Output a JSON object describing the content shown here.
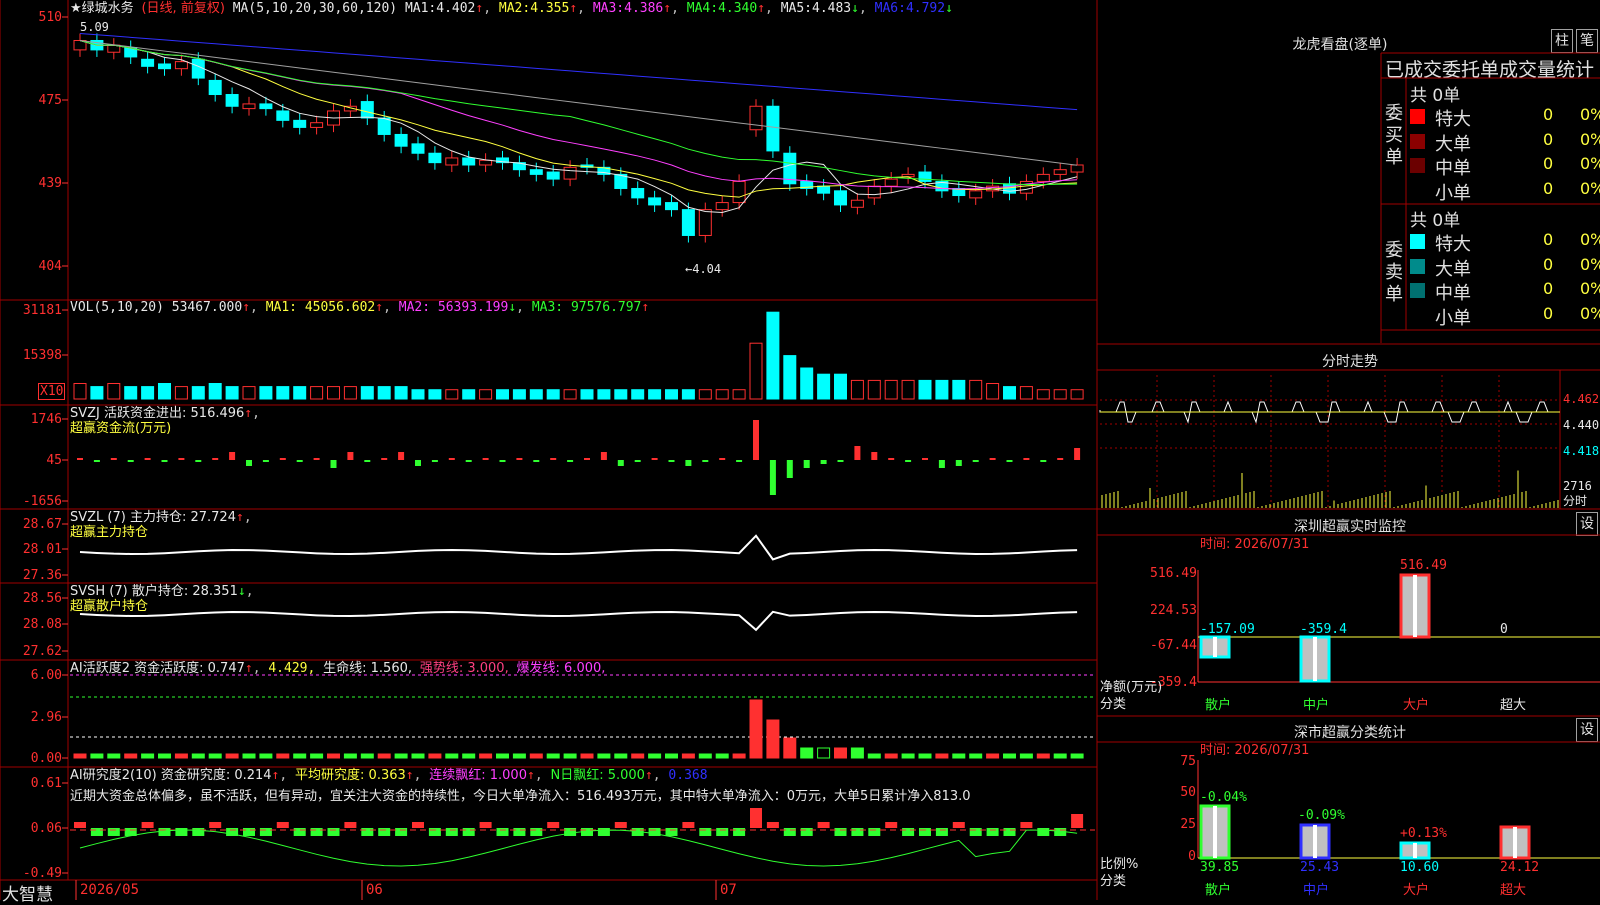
{
  "header": {
    "stock_name": "★绿城水务",
    "period": "(日线, 前复权)",
    "ma_label": "MA(5,10,20,30,60,120)",
    "ma": [
      {
        "label": "MA1:",
        "value": "4.402",
        "arrow": "↑"
      },
      {
        "label": "MA2:",
        "value": "4.355",
        "arrow": "↑"
      },
      {
        "label": "MA3:",
        "value": "4.386",
        "arrow": "↑"
      },
      {
        "label": "MA4:",
        "value": "4.340",
        "arrow": "↑"
      },
      {
        "label": "MA5:",
        "value": "4.483",
        "arrow": "↓"
      },
      {
        "label": "MA6:",
        "value": "4.792",
        "arrow": "↓"
      }
    ],
    "high_mark": "5.09",
    "low_mark": "←4.04"
  },
  "price_axis": [
    "510",
    "475",
    "439",
    "404"
  ],
  "vol": {
    "title": "VOL(5,10,20)",
    "value": "53467.000",
    "ma1": "MA1: 45056.602",
    "ma2": "MA2: 56393.199",
    "ma3": "MA3: 97576.797",
    "axis": [
      "31181",
      "15398"
    ],
    "unit": "X10"
  },
  "svzj": {
    "title": "SVZJ  活跃资金进出: 516.496",
    "subtitle": "超赢资金流(万元)",
    "axis": [
      "1746",
      "45",
      "-1656"
    ]
  },
  "svzl": {
    "title": "SVZL (7) 主力持仓: 27.724",
    "subtitle": "超赢主力持仓",
    "axis": [
      "28.67",
      "28.01",
      "27.36"
    ]
  },
  "svsh": {
    "title": "SVSH (7) 散户持仓: 28.351",
    "subtitle": "超赢散户持仓",
    "axis": [
      "28.56",
      "28.08",
      "27.62"
    ]
  },
  "ai1": {
    "title": "AI活跃度2 资金活跃度: 0.747",
    "v2": "4.429,",
    "life": "生命线: 1.560,",
    "strong": "强势线: 3.000,",
    "burst": "爆发线: 6.000,",
    "axis": [
      "6.00",
      "2.96",
      "0.00"
    ]
  },
  "ai2": {
    "title": "AI研究度2(10) 资金研究度: 0.214",
    "avg": "平均研究度: 0.363",
    "cont": "连续飘红: 1.000",
    "ndays": "N日飘红: 5.000",
    "last": "0.368",
    "comment": "近期大资金总体偏多，虽不活跃，但有异动，宜关注大资金的持续性，今日大单净流入：516.493万元，其中特大单净流入：0万元，大单5日累计净入813.0",
    "axis": [
      "0.61",
      "0.06",
      "-0.49"
    ]
  },
  "dates": {
    "brand": "大智慧",
    "d1": "2026/05",
    "d2": "06",
    "d3": "07"
  },
  "right": {
    "lhb_title": "龙虎看盘(逐单)",
    "btn1": "柱",
    "btn2": "笔",
    "stats_title": "已成交委托单成交量统计",
    "buy_label": "委买单",
    "sell_label": "委卖单",
    "buy_total": "共 0单",
    "sell_total": "共 0单",
    "buy_rows": [
      {
        "name": "特大",
        "count": "0",
        "pct": "0%",
        "color": "#ff0000"
      },
      {
        "name": "大单",
        "count": "0",
        "pct": "0%",
        "color": "#8b0000"
      },
      {
        "name": "中单",
        "count": "0",
        "pct": "0%",
        "color": "#6b0000"
      },
      {
        "name": "小单",
        "count": "0",
        "pct": "0%",
        "color": "#000000"
      }
    ],
    "sell_rows": [
      {
        "name": "特大",
        "count": "0",
        "pct": "0%",
        "color": "#00ffff"
      },
      {
        "name": "大单",
        "count": "0",
        "pct": "0%",
        "color": "#008b8b"
      },
      {
        "name": "中单",
        "count": "0",
        "pct": "0%",
        "color": "#007070"
      },
      {
        "name": "小单",
        "count": "0",
        "pct": "0%",
        "color": "#000000"
      }
    ],
    "fs_title": "分时走势",
    "fs_axis": [
      "4.462",
      "4.440",
      "4.418"
    ],
    "fs_vol": "2716",
    "fs_vol_label": "分时",
    "monitor_title": "深圳超赢实时监控",
    "monitor_btn": "设",
    "monitor_time": "时间: 2026/07/31",
    "monitor_axis": [
      "516.49",
      "224.53",
      "-67.44",
      "-359.4"
    ],
    "monitor_unit": "净额(万元)",
    "monitor_cat": "分类",
    "monitor_vals": {
      "sanhu": "-157.09",
      "zhonghu": "-359.4",
      "dahu": "516.49",
      "chaoda": "0"
    },
    "cats": [
      "散户",
      "中户",
      "大户",
      "超大"
    ],
    "class_title": "深市超赢分类统计",
    "class_btn": "设",
    "class_time": "时间: 2026/07/31",
    "class_axis": [
      "75",
      "50",
      "25",
      "0"
    ],
    "class_unit": "比例%",
    "class_cat": "分类",
    "class_pct": [
      "-0.04%",
      "-0.09%",
      "+0.13%",
      ""
    ],
    "class_vals": [
      "39.85",
      "25.43",
      "10.60",
      "24.12"
    ]
  }
}
